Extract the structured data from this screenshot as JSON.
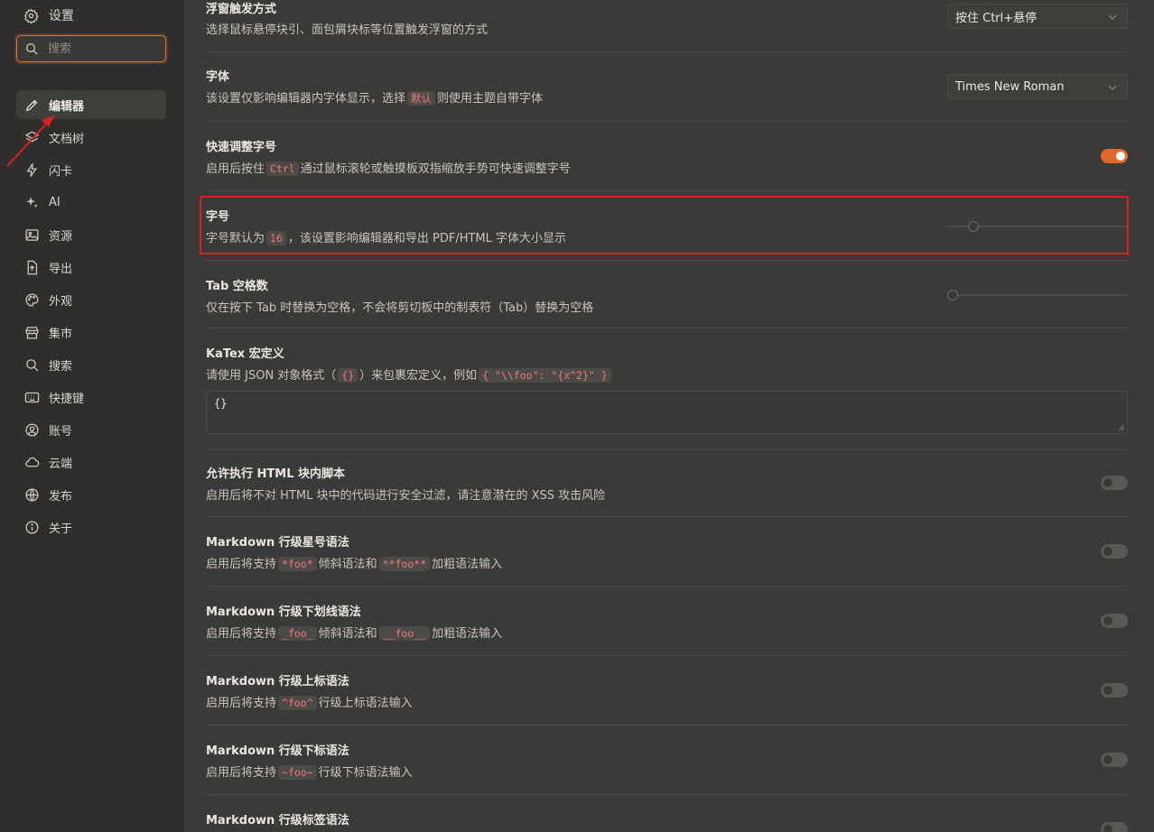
{
  "sidebar": {
    "title": "设置",
    "search": {
      "placeholder": "搜索",
      "value": ""
    },
    "items": [
      {
        "label": "编辑器",
        "icon": "pencil-icon",
        "active": true
      },
      {
        "label": "文档树",
        "icon": "layers-icon"
      },
      {
        "label": "闪卡",
        "icon": "flash-icon"
      },
      {
        "label": "AI",
        "icon": "sparkle-icon"
      },
      {
        "label": "资源",
        "icon": "image-icon"
      },
      {
        "label": "导出",
        "icon": "export-file-icon"
      },
      {
        "label": "外观",
        "icon": "palette-icon"
      },
      {
        "label": "集市",
        "icon": "store-icon"
      },
      {
        "label": "搜索",
        "icon": "search-icon"
      },
      {
        "label": "快捷键",
        "icon": "keyboard-icon"
      },
      {
        "label": "账号",
        "icon": "user-circle-icon"
      },
      {
        "label": "云端",
        "icon": "cloud-icon"
      },
      {
        "label": "发布",
        "icon": "globe-icon"
      },
      {
        "label": "关于",
        "icon": "info-icon"
      }
    ]
  },
  "settings": {
    "hover": {
      "title": "浮窗触发方式",
      "desc": "选择鼠标悬停块引、面包屑块标等位置触发浮窗的方式",
      "select_value": "按住 Ctrl+悬停"
    },
    "font": {
      "title": "字体",
      "desc_pre": "该设置仅影响编辑器内字体显示，选择",
      "desc_code": "默认",
      "desc_post": "则使用主题自带字体",
      "select_value": "Times New Roman"
    },
    "quick_font_size": {
      "title": "快速调整字号",
      "desc_pre": "启用后按住",
      "desc_code": "Ctrl",
      "desc_post": "通过鼠标滚轮或触摸板双指缩放手势可快速调整字号",
      "enabled": true
    },
    "font_size": {
      "title": "字号",
      "desc_pre": "字号默认为",
      "desc_code": "16",
      "desc_post": "，该设置影响编辑器和导出 PDF/HTML 字体大小显示",
      "value_fraction": 0.12
    },
    "tab_space": {
      "title": "Tab 空格数",
      "desc": "仅在按下 Tab 时替换为空格，不会将剪切板中的制表符（Tab）替换为空格",
      "value_fraction": 0.0
    },
    "katex": {
      "title": "KaTex 宏定义",
      "desc_pre": "请使用 JSON 对象格式（",
      "desc_code1": "{}",
      "desc_mid": "）来包裹宏定义，例如",
      "desc_code2": "{ \"\\\\foo\": \"{x^2}\" }",
      "textarea_value": "{}"
    },
    "html_script": {
      "title": "允许执行 HTML 块内脚本",
      "desc": "启用后将不对 HTML 块中的代码进行安全过滤，请注意潜在的 XSS 攻击风险",
      "enabled": false
    },
    "md_star": {
      "title": "Markdown 行级星号语法",
      "desc_pre": "启用后将支持",
      "desc_code1": "*foo*",
      "desc_mid": "倾斜语法和",
      "desc_code2": "**foo**",
      "desc_post": "加粗语法输入",
      "enabled": false
    },
    "md_underscore": {
      "title": "Markdown 行级下划线语法",
      "desc_pre": "启用后将支持",
      "desc_code1": "_foo_",
      "desc_mid": "倾斜语法和",
      "desc_code2": "__foo__",
      "desc_post": "加粗语法输入",
      "enabled": false
    },
    "md_sup": {
      "title": "Markdown 行级上标语法",
      "desc_pre": "启用后将支持",
      "desc_code": "^foo^",
      "desc_post": "行级上标语法输入",
      "enabled": false
    },
    "md_sub": {
      "title": "Markdown 行级下标语法",
      "desc_pre": "启用后将支持",
      "desc_code": "~foo~",
      "desc_post": "行级下标语法输入",
      "enabled": false
    },
    "md_tag": {
      "title": "Markdown 行级标签语法"
    }
  },
  "colors": {
    "accent": "#e0662c",
    "annotation_red": "#e02020",
    "code_text": "#ec7a7a"
  }
}
